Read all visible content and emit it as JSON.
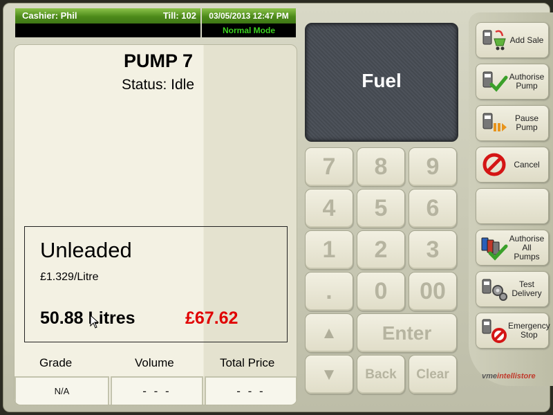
{
  "status_bar": {
    "cashier": "Cashier: Phil",
    "till": "Till: 102",
    "datetime": "03/05/2013 12:47 PM",
    "mode": "Normal Mode"
  },
  "pump": {
    "title": "PUMP 7",
    "status": "Status: Idle",
    "grade_name": "Unleaded",
    "price_per_litre": "£1.329/Litre",
    "litres": "50.88 Litres",
    "total": "£67.62",
    "columns": {
      "grade": "Grade",
      "volume": "Volume",
      "total_price": "Total Price"
    },
    "row": {
      "grade": "N/A",
      "volume": "- - -",
      "total_price": "- - -"
    }
  },
  "display": {
    "label": "Fuel"
  },
  "keypad": {
    "k7": "7",
    "k8": "8",
    "k9": "9",
    "k4": "4",
    "k5": "5",
    "k6": "6",
    "k1": "1",
    "k2": "2",
    "k3": "3",
    "kdot": ".",
    "k0": "0",
    "k00": "00",
    "up": "▲",
    "enter": "Enter",
    "down": "▼",
    "back": "Back",
    "clear": "Clear"
  },
  "side_buttons": {
    "add_sale": "Add Sale",
    "authorise_pump": "Authorise Pump",
    "pause_pump": "Pause Pump",
    "cancel": "Cancel",
    "authorise_all": "Authorise All Pumps",
    "test_delivery": "Test Delivery",
    "emergency_stop": "Emergency Stop"
  },
  "logo": {
    "brand_a": "vme",
    "brand_b": "intellistore"
  },
  "colors": {
    "status_green": "#4d8a1a",
    "mode_text": "#3bd21f",
    "total_red": "#e00000"
  }
}
